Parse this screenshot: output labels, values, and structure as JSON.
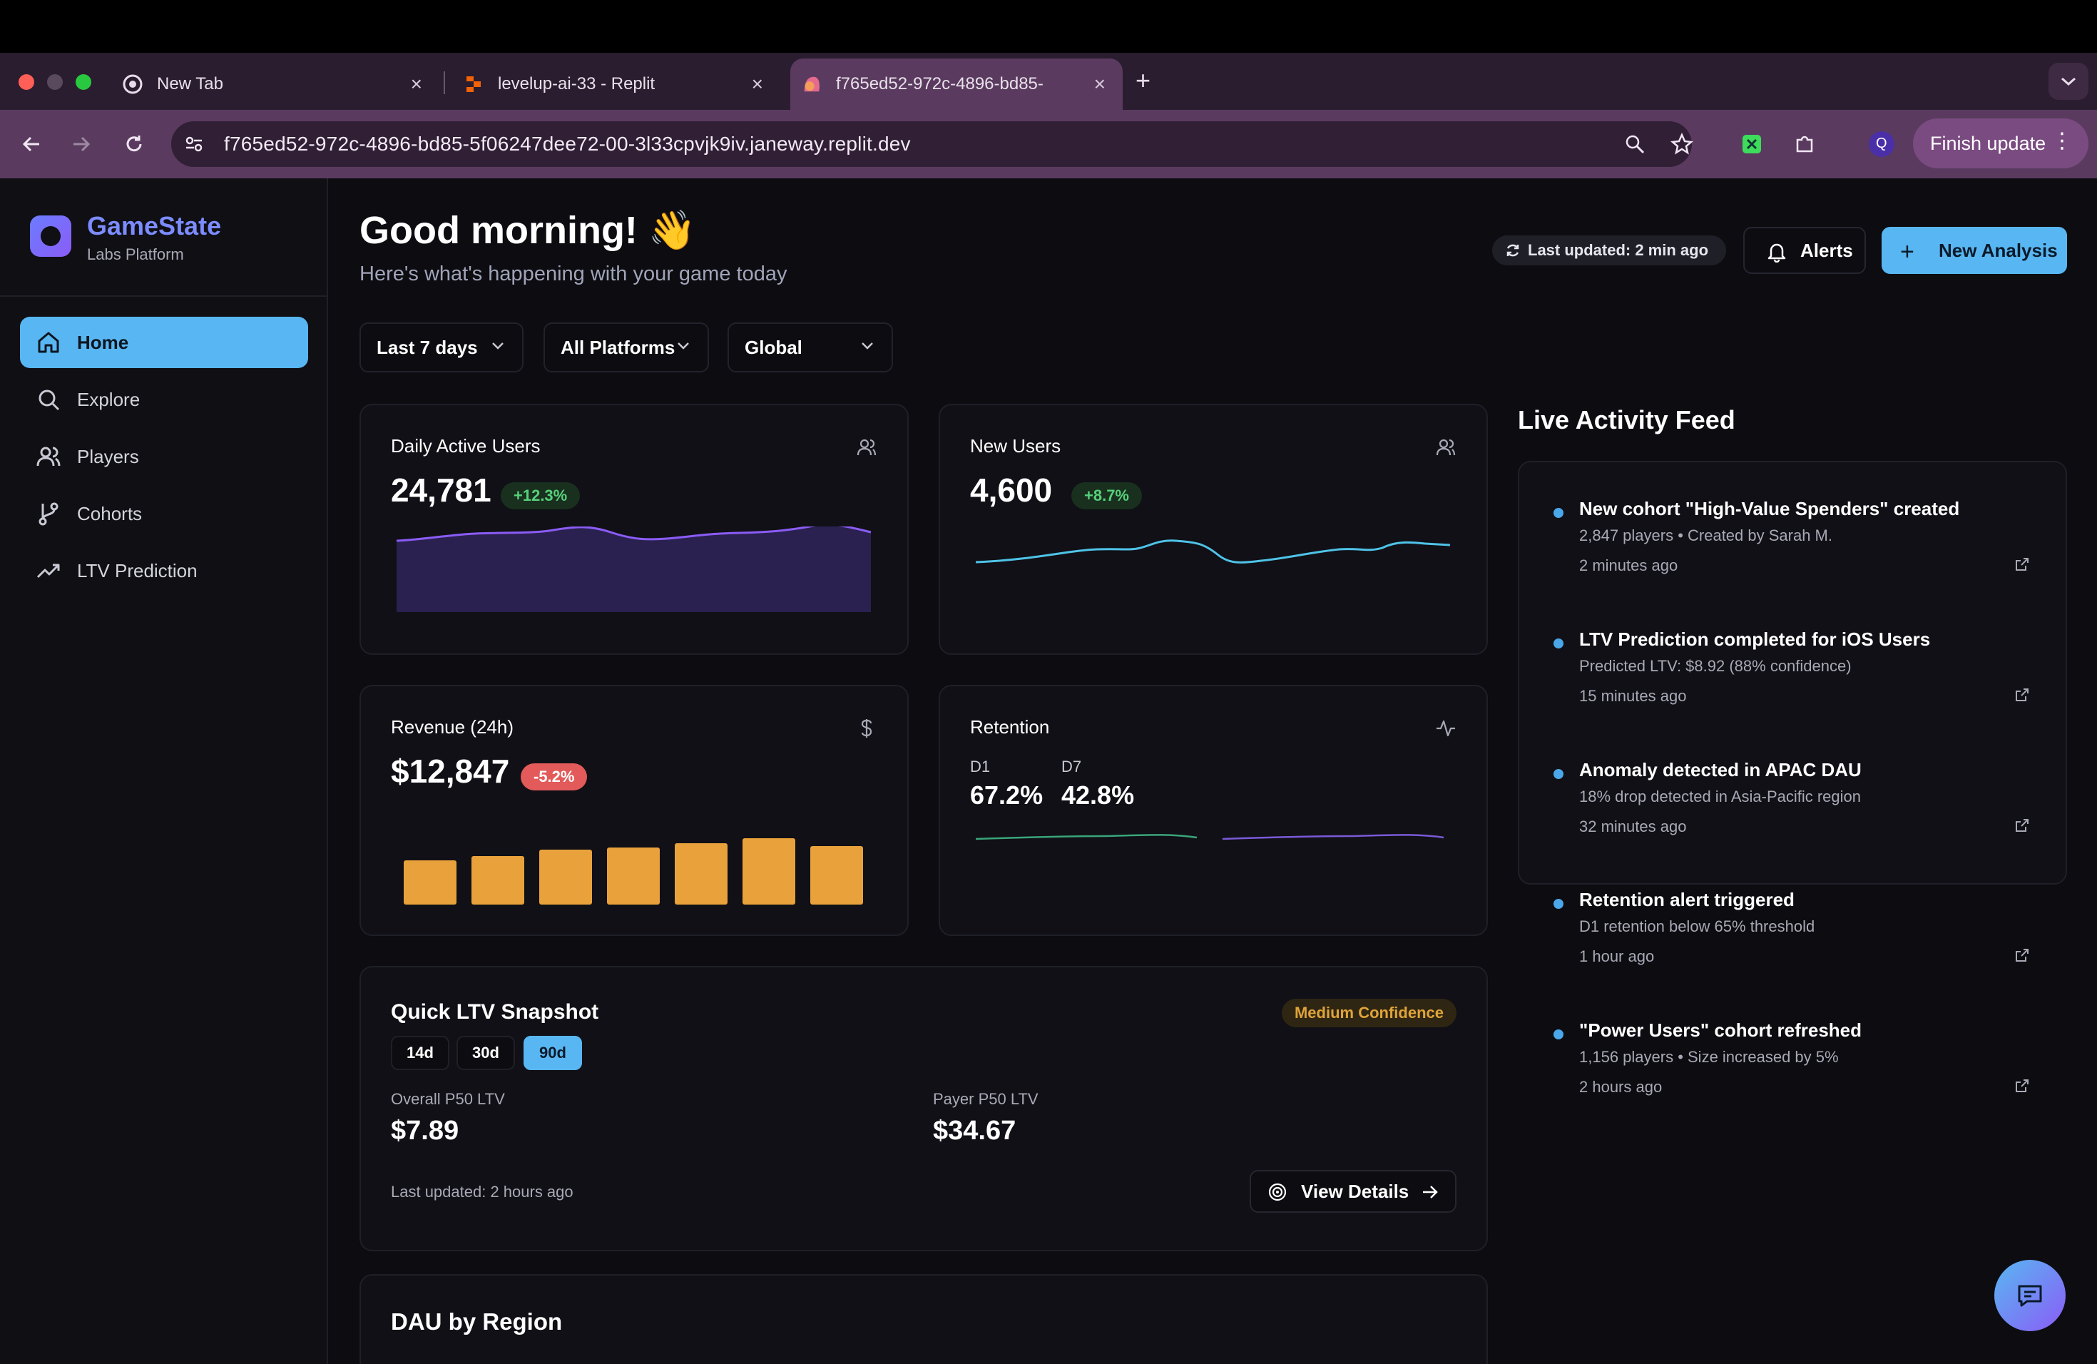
{
  "browser": {
    "tabs": [
      {
        "title": "New Tab"
      },
      {
        "title": "levelup-ai-33 - Replit"
      },
      {
        "title": "f765ed52-972c-4896-bd85-"
      }
    ],
    "url": "f765ed52-972c-4896-bd85-5f06247dee72-00-3l33cpvjk9iv.janeway.replit.dev",
    "profile_initial": "Q",
    "finish_update_label": "Finish update"
  },
  "sidebar": {
    "brand_name": "GameState",
    "brand_sub": "Labs Platform",
    "items": [
      {
        "label": "Home",
        "icon": "home-icon",
        "active": true
      },
      {
        "label": "Explore",
        "icon": "search-icon"
      },
      {
        "label": "Players",
        "icon": "users-icon"
      },
      {
        "label": "Cohorts",
        "icon": "branch-icon"
      },
      {
        "label": "LTV Prediction",
        "icon": "trending-up-icon"
      }
    ]
  },
  "header": {
    "title": "Good morning! 👋",
    "subtitle": "Here's what's happening with your game today",
    "last_updated": "Last updated: 2 min ago",
    "alerts_label": "Alerts",
    "new_analysis_label": "New Analysis"
  },
  "filters": {
    "period": "Last 7 days",
    "platform": "All Platforms",
    "region": "Global"
  },
  "metrics": {
    "dau": {
      "label": "Daily Active Users",
      "value": "24,781",
      "change": "+12.3%"
    },
    "new_users": {
      "label": "New Users",
      "value": "4,600",
      "change": "+8.7%"
    },
    "revenue": {
      "label": "Revenue (24h)",
      "value": "$12,847",
      "change": "-5.2%",
      "bars": [
        0.62,
        0.68,
        0.77,
        0.8,
        0.86,
        0.93,
        0.82
      ]
    },
    "retention": {
      "label": "Retention",
      "d1_label": "D1",
      "d1_value": "67.2%",
      "d7_label": "D7",
      "d7_value": "42.8%"
    }
  },
  "ltv": {
    "title": "Quick LTV Snapshot",
    "confidence": "Medium Confidence",
    "segments": [
      "14d",
      "30d",
      "90d"
    ],
    "selected_segment": "90d",
    "overall_label": "Overall P50 LTV",
    "overall_value": "$7.89",
    "payer_label": "Payer P50 LTV",
    "payer_value": "$34.67",
    "last_updated": "Last updated: 2 hours ago",
    "view_details_label": "View Details"
  },
  "dau_region": {
    "title": "DAU by Region"
  },
  "feed": {
    "title": "Live Activity Feed",
    "items": [
      {
        "title": "New cohort \"High-Value Spenders\" created",
        "sub": "2,847 players • Created by Sarah M.",
        "time": "2 minutes ago"
      },
      {
        "title": "LTV Prediction completed for iOS Users",
        "sub": "Predicted LTV: $8.92 (88% confidence)",
        "time": "15 minutes ago"
      },
      {
        "title": "Anomaly detected in APAC DAU",
        "sub": "18% drop detected in Asia-Pacific region",
        "time": "32 minutes ago"
      },
      {
        "title": "Retention alert triggered",
        "sub": "D1 retention below 65% threshold",
        "time": "1 hour ago"
      },
      {
        "title": "\"Power Users\" cohort refreshed",
        "sub": "1,156 players • Size increased by 5%",
        "time": "2 hours ago"
      }
    ]
  },
  "colors": {
    "accent": "#58b7f2",
    "brand": "#7c8cff",
    "revenue_bar": "#e9a23b",
    "dau_line": "#8b5cf6",
    "new_users_line": "#4fc3e8",
    "positive": "#57d07a",
    "negative": "#e35a5a"
  }
}
